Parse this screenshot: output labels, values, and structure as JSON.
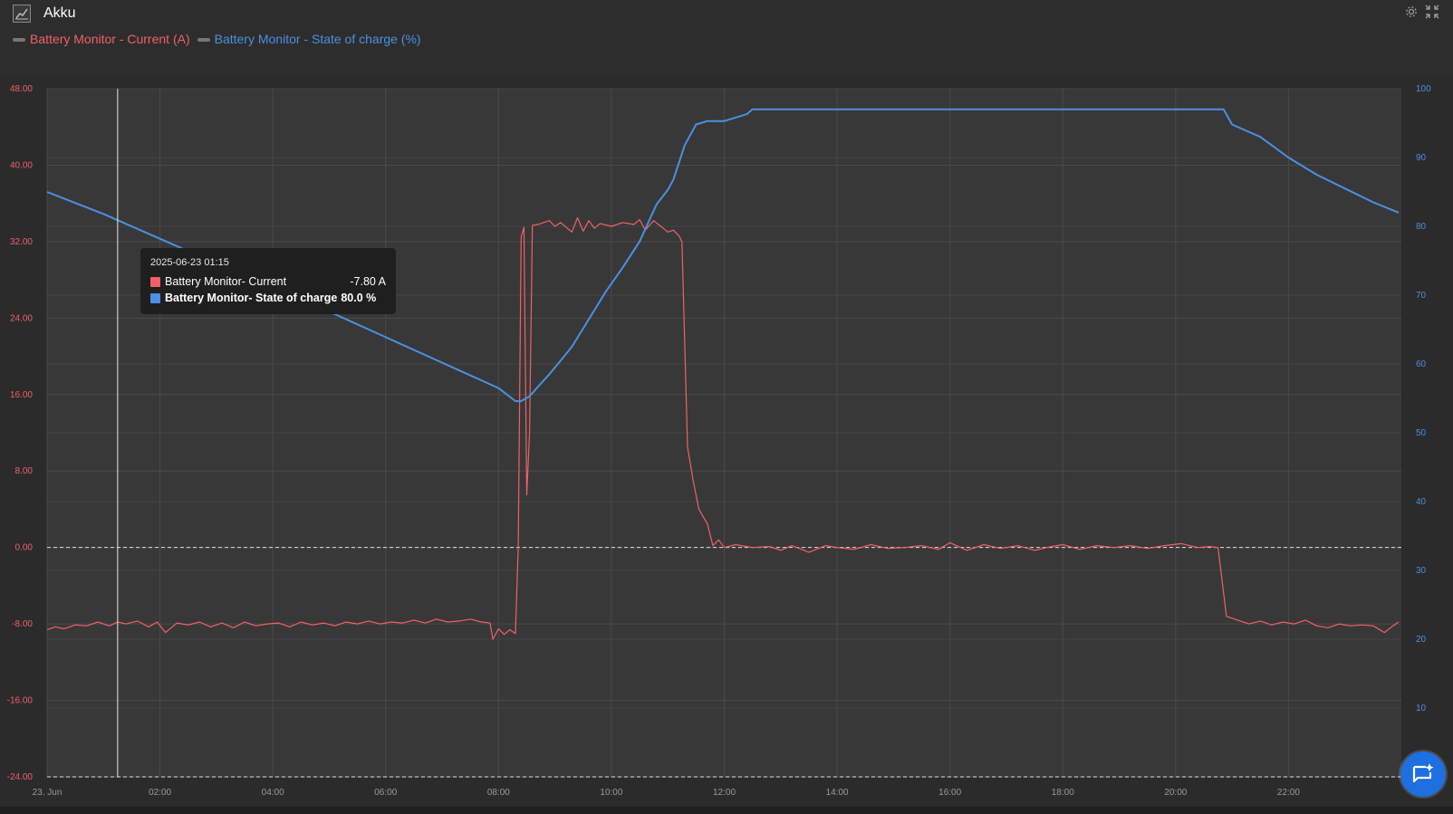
{
  "window": {
    "title": "Akku"
  },
  "legend": {
    "items": [
      {
        "label": "Battery Monitor - Current (A)",
        "color": "#f0606a"
      },
      {
        "label": "Battery Monitor - State of charge (%)",
        "color": "#4a90e2"
      }
    ]
  },
  "tooltip": {
    "date": "2025-06-23 01:15",
    "rows": [
      {
        "name": "Battery Monitor- Current",
        "value": "-7.80 A",
        "color": "#f0606a"
      },
      {
        "name": "Battery Monitor- State of charge",
        "value": "80.0 %",
        "color": "#4a90e2"
      }
    ]
  },
  "icons": {
    "app": "chart-icon",
    "settings": "gear-icon",
    "collapse": "collapse-icon",
    "chat": "chat-icon"
  },
  "chart_data": {
    "type": "line",
    "title": "Akku",
    "xlim": [
      0,
      24
    ],
    "x_ticks": [
      0,
      2,
      4,
      6,
      8,
      10,
      12,
      14,
      16,
      18,
      20,
      22
    ],
    "x_tick_labels": [
      "23. Jun",
      "02:00",
      "04:00",
      "06:00",
      "08:00",
      "10:00",
      "12:00",
      "14:00",
      "16:00",
      "18:00",
      "20:00",
      "22:00"
    ],
    "y_left": {
      "lim": [
        -24,
        48
      ],
      "ticks": [
        48,
        40,
        32,
        24,
        16,
        8,
        0,
        -8,
        -16,
        -24
      ],
      "tick_labels": [
        "48.00",
        "40.00",
        "32.00",
        "24.00",
        "16.00",
        "8.00",
        "0.00",
        "-8.00",
        "-16.00",
        "-24.00"
      ],
      "color": "#f0606a"
    },
    "y_right": {
      "lim": [
        0,
        100
      ],
      "ticks": [
        100,
        90,
        80,
        70,
        60,
        50,
        40,
        30,
        20,
        10
      ],
      "tick_labels": [
        "100",
        "90",
        "80",
        "70",
        "60",
        "50",
        "40",
        "30",
        "20",
        "10"
      ],
      "color": "#4a90e2"
    },
    "reference_lines": [
      0,
      -24
    ],
    "cursor_x": 1.25,
    "series": [
      {
        "name": "Battery Monitor - Current (A)",
        "axis": "left",
        "color": "#f0606a",
        "points": [
          [
            0,
            -8.6
          ],
          [
            0.15,
            -8.3
          ],
          [
            0.3,
            -8.5
          ],
          [
            0.5,
            -8.1
          ],
          [
            0.7,
            -8.2
          ],
          [
            0.9,
            -7.8
          ],
          [
            1.1,
            -8.2
          ],
          [
            1.25,
            -7.8
          ],
          [
            1.4,
            -8.0
          ],
          [
            1.6,
            -7.7
          ],
          [
            1.8,
            -8.3
          ],
          [
            1.95,
            -7.8
          ],
          [
            2.1,
            -8.9
          ],
          [
            2.3,
            -7.9
          ],
          [
            2.5,
            -8.1
          ],
          [
            2.7,
            -7.8
          ],
          [
            2.9,
            -8.3
          ],
          [
            3.1,
            -7.9
          ],
          [
            3.3,
            -8.4
          ],
          [
            3.5,
            -7.8
          ],
          [
            3.7,
            -8.2
          ],
          [
            3.9,
            -8.0
          ],
          [
            4.1,
            -7.9
          ],
          [
            4.3,
            -8.3
          ],
          [
            4.5,
            -7.8
          ],
          [
            4.7,
            -8.1
          ],
          [
            4.9,
            -7.9
          ],
          [
            5.1,
            -8.2
          ],
          [
            5.3,
            -7.8
          ],
          [
            5.5,
            -8.0
          ],
          [
            5.7,
            -7.7
          ],
          [
            5.9,
            -8.0
          ],
          [
            6.1,
            -7.8
          ],
          [
            6.3,
            -7.9
          ],
          [
            6.5,
            -7.6
          ],
          [
            6.7,
            -7.9
          ],
          [
            6.9,
            -7.5
          ],
          [
            7.1,
            -7.8
          ],
          [
            7.3,
            -7.7
          ],
          [
            7.5,
            -7.5
          ],
          [
            7.7,
            -7.8
          ],
          [
            7.85,
            -7.9
          ],
          [
            7.9,
            -9.6
          ],
          [
            8.0,
            -8.5
          ],
          [
            8.1,
            -9.1
          ],
          [
            8.2,
            -8.6
          ],
          [
            8.3,
            -9.0
          ],
          [
            8.35,
            0.0
          ],
          [
            8.4,
            32.5
          ],
          [
            8.45,
            33.5
          ],
          [
            8.5,
            5.5
          ],
          [
            8.55,
            12.0
          ],
          [
            8.6,
            33.7
          ],
          [
            8.7,
            33.8
          ],
          [
            8.9,
            34.2
          ],
          [
            9.0,
            33.6
          ],
          [
            9.1,
            34.0
          ],
          [
            9.3,
            33.0
          ],
          [
            9.4,
            34.5
          ],
          [
            9.5,
            33.1
          ],
          [
            9.6,
            34.2
          ],
          [
            9.7,
            33.4
          ],
          [
            9.8,
            33.9
          ],
          [
            10.0,
            33.6
          ],
          [
            10.2,
            34.0
          ],
          [
            10.4,
            33.8
          ],
          [
            10.5,
            34.3
          ],
          [
            10.6,
            33.2
          ],
          [
            10.75,
            34.2
          ],
          [
            10.9,
            33.5
          ],
          [
            11.0,
            33.0
          ],
          [
            11.1,
            33.2
          ],
          [
            11.2,
            32.6
          ],
          [
            11.25,
            32.0
          ],
          [
            11.35,
            10.5
          ],
          [
            11.45,
            7.0
          ],
          [
            11.55,
            4.0
          ],
          [
            11.7,
            2.5
          ],
          [
            11.8,
            0.2
          ],
          [
            11.9,
            0.8
          ],
          [
            12.0,
            0.0
          ],
          [
            12.2,
            0.3
          ],
          [
            12.5,
            0.0
          ],
          [
            12.8,
            0.1
          ],
          [
            13.0,
            -0.3
          ],
          [
            13.2,
            0.2
          ],
          [
            13.5,
            -0.5
          ],
          [
            13.8,
            0.2
          ],
          [
            14.0,
            0.0
          ],
          [
            14.3,
            -0.2
          ],
          [
            14.6,
            0.3
          ],
          [
            14.9,
            -0.1
          ],
          [
            15.2,
            0.0
          ],
          [
            15.5,
            0.2
          ],
          [
            15.8,
            -0.2
          ],
          [
            16.0,
            0.5
          ],
          [
            16.3,
            -0.3
          ],
          [
            16.6,
            0.3
          ],
          [
            16.9,
            -0.1
          ],
          [
            17.2,
            0.2
          ],
          [
            17.5,
            -0.3
          ],
          [
            17.8,
            0.1
          ],
          [
            18.0,
            0.3
          ],
          [
            18.3,
            -0.2
          ],
          [
            18.6,
            0.2
          ],
          [
            18.9,
            0.0
          ],
          [
            19.2,
            0.2
          ],
          [
            19.5,
            -0.1
          ],
          [
            19.8,
            0.2
          ],
          [
            20.1,
            0.4
          ],
          [
            20.4,
            0.0
          ],
          [
            20.6,
            0.1
          ],
          [
            20.75,
            0.0
          ],
          [
            20.9,
            -7.2
          ],
          [
            21.1,
            -7.6
          ],
          [
            21.3,
            -8.0
          ],
          [
            21.5,
            -7.7
          ],
          [
            21.7,
            -8.1
          ],
          [
            21.9,
            -7.8
          ],
          [
            22.1,
            -8.0
          ],
          [
            22.3,
            -7.6
          ],
          [
            22.5,
            -8.2
          ],
          [
            22.7,
            -8.4
          ],
          [
            22.9,
            -8.0
          ],
          [
            23.1,
            -8.2
          ],
          [
            23.3,
            -8.1
          ],
          [
            23.5,
            -8.2
          ],
          [
            23.7,
            -8.9
          ],
          [
            23.85,
            -8.2
          ],
          [
            23.95,
            -7.8
          ]
        ]
      },
      {
        "name": "Battery Monitor - State of charge (%)",
        "axis": "right",
        "color": "#4a90e2",
        "points": [
          [
            0,
            85
          ],
          [
            0.5,
            83.4
          ],
          [
            1.0,
            81.8
          ],
          [
            1.25,
            80.9
          ],
          [
            2.0,
            78.2
          ],
          [
            3.0,
            74.6
          ],
          [
            4.0,
            71.2
          ],
          [
            5.0,
            67.6
          ],
          [
            6.0,
            63.9
          ],
          [
            7.0,
            60.2
          ],
          [
            8.0,
            56.5
          ],
          [
            8.3,
            54.6
          ],
          [
            8.4,
            54.6
          ],
          [
            8.55,
            55.3
          ],
          [
            8.7,
            56.7
          ],
          [
            8.9,
            58.5
          ],
          [
            9.1,
            60.5
          ],
          [
            9.3,
            62.5
          ],
          [
            9.6,
            66.5
          ],
          [
            9.9,
            70.5
          ],
          [
            10.2,
            74.0
          ],
          [
            10.5,
            77.8
          ],
          [
            10.8,
            83.2
          ],
          [
            11.0,
            85.3
          ],
          [
            11.1,
            86.8
          ],
          [
            11.3,
            91.8
          ],
          [
            11.5,
            94.8
          ],
          [
            11.7,
            95.3
          ],
          [
            12.0,
            95.3
          ],
          [
            12.4,
            96.3
          ],
          [
            12.5,
            97.0
          ],
          [
            13.0,
            97.0
          ],
          [
            20.0,
            97.0
          ],
          [
            20.85,
            97.0
          ],
          [
            21.0,
            94.8
          ],
          [
            21.5,
            93.0
          ],
          [
            22.0,
            90.0
          ],
          [
            22.5,
            87.5
          ],
          [
            23.0,
            85.5
          ],
          [
            23.5,
            83.5
          ],
          [
            23.95,
            82.0
          ]
        ]
      }
    ],
    "grid": true,
    "legend_position": "top-left"
  }
}
